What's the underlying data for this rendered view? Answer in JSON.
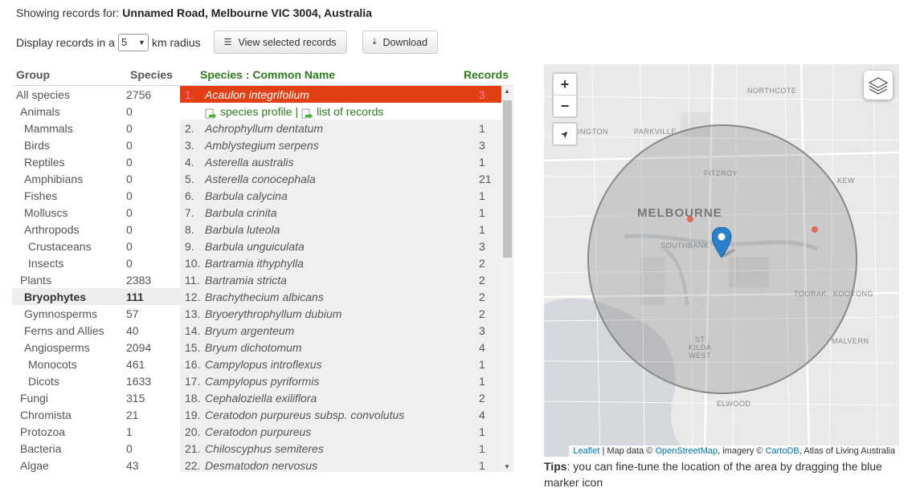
{
  "header": {
    "showing_label": "Showing records for:",
    "address": "Unnamed Road, Melbourne VIC 3004, Australia"
  },
  "controls": {
    "display_label": "Display records in a",
    "radius_value": "5",
    "radius_unit": "km radius",
    "view_selected_label": "View selected records",
    "download_label": "Download"
  },
  "groups": {
    "headers": {
      "group": "Group",
      "species": "Species"
    },
    "rows": [
      {
        "name": "All species",
        "count": "2756",
        "indent": 0
      },
      {
        "name": "Animals",
        "count": "0",
        "indent": 1
      },
      {
        "name": "Mammals",
        "count": "0",
        "indent": 2
      },
      {
        "name": "Birds",
        "count": "0",
        "indent": 2
      },
      {
        "name": "Reptiles",
        "count": "0",
        "indent": 2
      },
      {
        "name": "Amphibians",
        "count": "0",
        "indent": 2
      },
      {
        "name": "Fishes",
        "count": "0",
        "indent": 2
      },
      {
        "name": "Molluscs",
        "count": "0",
        "indent": 2
      },
      {
        "name": "Arthropods",
        "count": "0",
        "indent": 2
      },
      {
        "name": "Crustaceans",
        "count": "0",
        "indent": 3
      },
      {
        "name": "Insects",
        "count": "0",
        "indent": 3
      },
      {
        "name": "Plants",
        "count": "2383",
        "indent": 1
      },
      {
        "name": "Bryophytes",
        "count": "111",
        "indent": 2,
        "active": true
      },
      {
        "name": "Gymnosperms",
        "count": "57",
        "indent": 2
      },
      {
        "name": "Ferns and Allies",
        "count": "40",
        "indent": 2
      },
      {
        "name": "Angiosperms",
        "count": "2094",
        "indent": 2
      },
      {
        "name": "Monocots",
        "count": "461",
        "indent": 3
      },
      {
        "name": "Dicots",
        "count": "1633",
        "indent": 3
      },
      {
        "name": "Fungi",
        "count": "315",
        "indent": 1
      },
      {
        "name": "Chromista",
        "count": "21",
        "indent": 1
      },
      {
        "name": "Protozoa",
        "count": "1",
        "indent": 1
      },
      {
        "name": "Bacteria",
        "count": "0",
        "indent": 1
      },
      {
        "name": "Algae",
        "count": "43",
        "indent": 1
      }
    ]
  },
  "species": {
    "headers": {
      "name": "Species : Common Name",
      "records": "Records"
    },
    "selected_links": {
      "profile": "species profile",
      "separator": "|",
      "records": "list of records"
    },
    "rows": [
      {
        "num": "1.",
        "name": "Acaulon integrifolium",
        "records": "3",
        "selected": true
      },
      {
        "num": "2.",
        "name": "Achrophyllum dentatum",
        "records": "1"
      },
      {
        "num": "3.",
        "name": "Amblystegium serpens",
        "records": "3"
      },
      {
        "num": "4.",
        "name": "Asterella australis",
        "records": "1"
      },
      {
        "num": "5.",
        "name": "Asterella conocephala",
        "records": "21"
      },
      {
        "num": "6.",
        "name": "Barbula calycina",
        "records": "1"
      },
      {
        "num": "7.",
        "name": "Barbula crinita",
        "records": "1"
      },
      {
        "num": "8.",
        "name": "Barbula luteola",
        "records": "1"
      },
      {
        "num": "9.",
        "name": "Barbula unguiculata",
        "records": "3"
      },
      {
        "num": "10.",
        "name": "Bartramia ithyphylla",
        "records": "2"
      },
      {
        "num": "11.",
        "name": "Bartramia stricta",
        "records": "2"
      },
      {
        "num": "12.",
        "name": "Brachythecium albicans",
        "records": "2"
      },
      {
        "num": "13.",
        "name": "Bryoerythrophyllum dubium",
        "records": "2"
      },
      {
        "num": "14.",
        "name": "Bryum argenteum",
        "records": "3"
      },
      {
        "num": "15.",
        "name": "Bryum dichotomum",
        "records": "4"
      },
      {
        "num": "16.",
        "name": "Campylopus introflexus",
        "records": "1"
      },
      {
        "num": "17.",
        "name": "Campylopus pyriformis",
        "records": "1"
      },
      {
        "num": "18.",
        "name": "Cephaloziella exiliflora",
        "records": "2"
      },
      {
        "num": "19.",
        "name": "Ceratodon purpureus subsp. convolutus",
        "records": "4"
      },
      {
        "num": "20.",
        "name": "Ceratodon purpureus",
        "records": "1"
      },
      {
        "num": "21.",
        "name": "Chiloscyphus semiteres",
        "records": "1"
      },
      {
        "num": "22.",
        "name": "Desmatodon nervosus",
        "records": "1"
      }
    ]
  },
  "map": {
    "labels": [
      "NORTHCOTE",
      "PARKVILLE",
      "FITZROY",
      "KEW",
      "MELBOURNE",
      "SOUTHBANK",
      "TOORAK",
      "KOOYONG",
      "ST KILDA WEST",
      "MALVERN",
      "ELWOOD"
    ],
    "partial_label": "INGTON",
    "zoom_in": "+",
    "zoom_out": "−",
    "attribution": {
      "leaflet": "Leaflet",
      "map_data": "| Map data ©",
      "osm": "OpenStreetMap",
      "imagery": ", imagery ©",
      "carto": "CartoDB",
      "ala": ", Atlas of Living Australia"
    }
  },
  "tips": {
    "label": "Tips",
    "text": ": you can fine-tune the location of the area by dragging the blue marker icon"
  }
}
